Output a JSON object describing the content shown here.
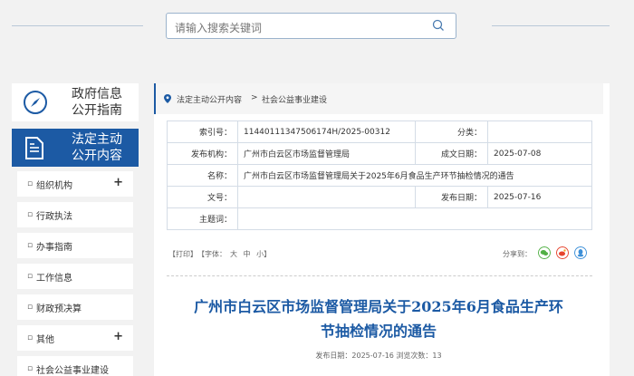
{
  "search": {
    "placeholder": "请输入搜索关键词"
  },
  "sidebar": {
    "guide": {
      "line1": "政府信息",
      "line2": "公开指南"
    },
    "active": {
      "line1": "法定主动",
      "line2": "公开内容"
    },
    "items": [
      {
        "label": "组织机构",
        "expand": "+"
      },
      {
        "label": "行政执法",
        "expand": ""
      },
      {
        "label": "办事指南",
        "expand": ""
      },
      {
        "label": "工作信息",
        "expand": ""
      },
      {
        "label": "财政预决算",
        "expand": ""
      },
      {
        "label": "其他",
        "expand": "+"
      },
      {
        "label": "社会公益事业建设",
        "expand": ""
      }
    ]
  },
  "breadcrumb": {
    "level1": "法定主动公开内容",
    "sep": ">",
    "level2": "社会公益事业建设"
  },
  "meta": {
    "index_label": "索引号：",
    "index_value": "11440111347506174H/2025-00312",
    "category_label": "分类：",
    "category_value": "",
    "issuer_label": "发布机构：",
    "issuer_value": "广州市白云区市场监督管理局",
    "created_label": "成文日期：",
    "created_value": "2025-07-08",
    "name_label": "名称：",
    "name_value": "广州市白云区市场监督管理局关于2025年6月食品生产环节抽检情况的通告",
    "docno_label": "文号：",
    "docno_value": "",
    "pubdate_label": "发布日期：",
    "pubdate_value": "2025-07-16",
    "subject_label": "主题词：",
    "subject_value": ""
  },
  "tools": {
    "print": "【打印】",
    "font": "【字体：",
    "large": "大",
    "medium": "中",
    "small": "小】"
  },
  "share": {
    "label": "分享到："
  },
  "article": {
    "title_line1": "广州市白云区市场监督管理局关于2025年6月食品生产环",
    "title_line2": "节抽检情况的通告",
    "pubinfo": "发布日期：2025-07-16    浏览次数：13"
  },
  "colors": {
    "accent": "#1c5aa4",
    "wechat": "#52b045",
    "weibo": "#e6432d",
    "qq": "#3b8fd8"
  }
}
